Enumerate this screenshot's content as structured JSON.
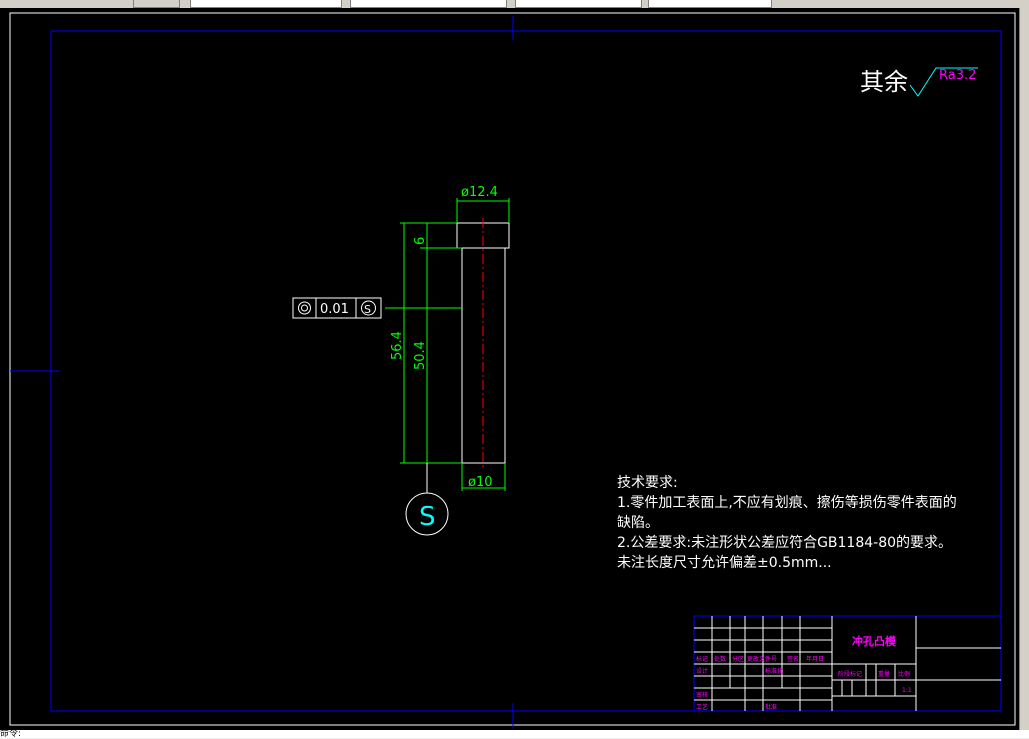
{
  "title_note": {
    "prefix": "其余",
    "roughness": "Ra3.2"
  },
  "dimensions": {
    "top_diameter": "ø12.4",
    "bottom_diameter": "ø10",
    "head_height": "6",
    "total_length": "56.4",
    "shaft_length": "50.4"
  },
  "tolerance_frame": {
    "symbol": "◎",
    "value": "0.01",
    "modifier": "S"
  },
  "datum": {
    "label": "S"
  },
  "tech_requirements": {
    "heading": "技术要求:",
    "line1": "1.零件加工表面上,不应有划痕、擦伤等损伤零件表面的",
    "line2": "缺陷。",
    "line3": "2.公差要求:未注形状公差应符合GB1184-80的要求。",
    "line4": "未注长度尺寸允许偏差±0.5mm..."
  },
  "title_block": {
    "part_name": "冲孔凸模",
    "row_labels": [
      "标记",
      "处数",
      "分区",
      "更改文件号",
      "签名",
      "年月日"
    ],
    "design": "设计",
    "standard": "标准化",
    "stage_mark": "阶段标记",
    "weight": "重量",
    "ratio": "比例",
    "ratio_value": "1:1",
    "review": "审核",
    "process": "工艺",
    "approve": "批准"
  },
  "command_line": {
    "text": "命令:"
  },
  "colors": {
    "background": "#000000",
    "border": "#0000ff",
    "dimension": "#00ff00",
    "center_line": "#ff0000",
    "text": "#ffffff",
    "magenta": "#ff00ff"
  }
}
